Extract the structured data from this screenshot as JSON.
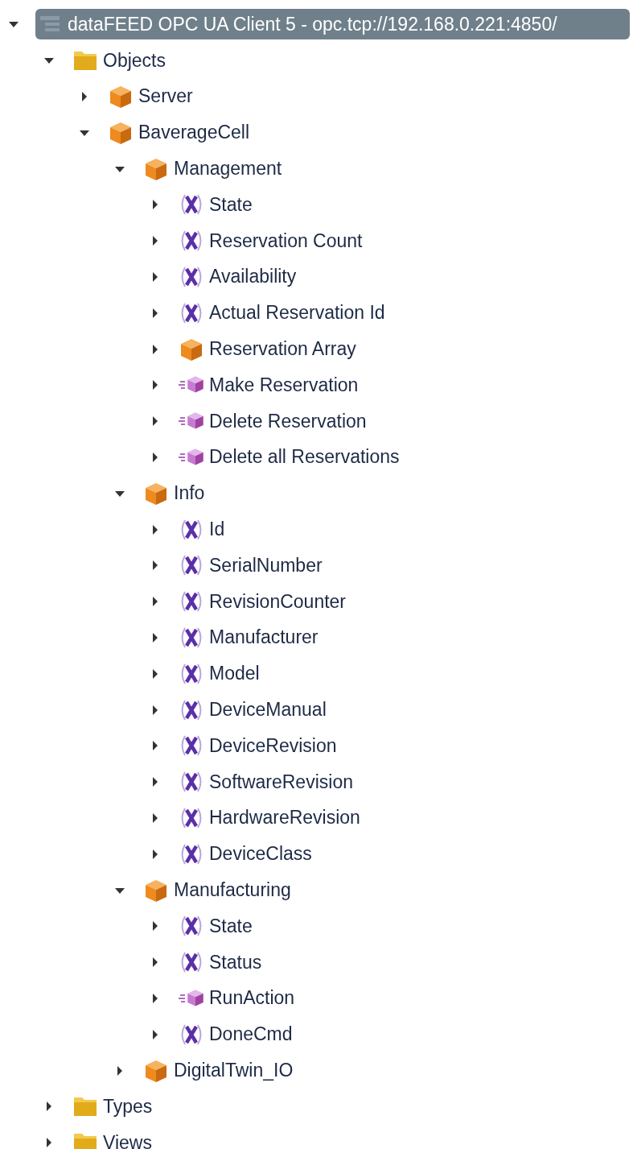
{
  "tree": [
    {
      "label": "dataFEED OPC UA Client 5 - opc.tcp://192.168.0.221:4850/",
      "kind": "server",
      "expanded": true,
      "selected": true,
      "children": [
        {
          "label": "Objects",
          "kind": "folder",
          "expanded": true,
          "selected": false,
          "children": [
            {
              "label": "Server",
              "kind": "object",
              "expanded": false,
              "selected": false
            },
            {
              "label": "BaverageCell",
              "kind": "object",
              "expanded": true,
              "selected": false,
              "children": [
                {
                  "label": "Management",
                  "kind": "object",
                  "expanded": true,
                  "selected": false,
                  "children": [
                    {
                      "label": "State",
                      "kind": "variable",
                      "expanded": false,
                      "selected": false
                    },
                    {
                      "label": "Reservation Count",
                      "kind": "variable",
                      "expanded": false,
                      "selected": false
                    },
                    {
                      "label": "Availability",
                      "kind": "variable",
                      "expanded": false,
                      "selected": false
                    },
                    {
                      "label": "Actual Reservation Id",
                      "kind": "variable",
                      "expanded": false,
                      "selected": false
                    },
                    {
                      "label": "Reservation Array",
                      "kind": "object",
                      "expanded": false,
                      "selected": false
                    },
                    {
                      "label": "Make Reservation",
                      "kind": "method",
                      "expanded": false,
                      "selected": false
                    },
                    {
                      "label": "Delete Reservation",
                      "kind": "method",
                      "expanded": false,
                      "selected": false
                    },
                    {
                      "label": "Delete all Reservations",
                      "kind": "method",
                      "expanded": false,
                      "selected": false
                    }
                  ]
                },
                {
                  "label": "Info",
                  "kind": "object",
                  "expanded": true,
                  "selected": false,
                  "children": [
                    {
                      "label": "Id",
                      "kind": "variable",
                      "expanded": false,
                      "selected": false
                    },
                    {
                      "label": "SerialNumber",
                      "kind": "variable",
                      "expanded": false,
                      "selected": false
                    },
                    {
                      "label": "RevisionCounter",
                      "kind": "variable",
                      "expanded": false,
                      "selected": false
                    },
                    {
                      "label": "Manufacturer",
                      "kind": "variable",
                      "expanded": false,
                      "selected": false
                    },
                    {
                      "label": "Model",
                      "kind": "variable",
                      "expanded": false,
                      "selected": false
                    },
                    {
                      "label": "DeviceManual",
                      "kind": "variable",
                      "expanded": false,
                      "selected": false
                    },
                    {
                      "label": "DeviceRevision",
                      "kind": "variable",
                      "expanded": false,
                      "selected": false
                    },
                    {
                      "label": "SoftwareRevision",
                      "kind": "variable",
                      "expanded": false,
                      "selected": false
                    },
                    {
                      "label": "HardwareRevision",
                      "kind": "variable",
                      "expanded": false,
                      "selected": false
                    },
                    {
                      "label": "DeviceClass",
                      "kind": "variable",
                      "expanded": false,
                      "selected": false
                    }
                  ]
                },
                {
                  "label": "Manufacturing",
                  "kind": "object",
                  "expanded": true,
                  "selected": false,
                  "children": [
                    {
                      "label": "State",
                      "kind": "variable",
                      "expanded": false,
                      "selected": false
                    },
                    {
                      "label": "Status",
                      "kind": "variable",
                      "expanded": false,
                      "selected": false
                    },
                    {
                      "label": "RunAction",
                      "kind": "method",
                      "expanded": false,
                      "selected": false
                    },
                    {
                      "label": "DoneCmd",
                      "kind": "variable",
                      "expanded": false,
                      "selected": false
                    }
                  ]
                },
                {
                  "label": "DigitalTwin_IO",
                  "kind": "object",
                  "expanded": false,
                  "selected": false
                }
              ]
            }
          ]
        },
        {
          "label": "Types",
          "kind": "folder",
          "expanded": false,
          "selected": false
        },
        {
          "label": "Views",
          "kind": "folder",
          "expanded": false,
          "selected": false
        }
      ]
    }
  ]
}
